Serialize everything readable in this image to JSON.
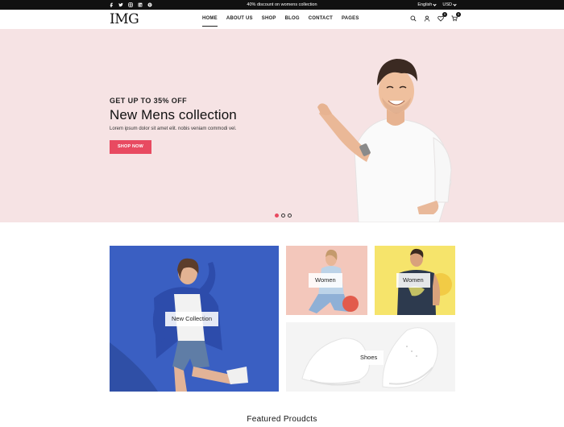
{
  "topbar": {
    "socials": [
      "facebook-icon",
      "twitter-icon",
      "instagram-icon",
      "linkedin-icon",
      "pinterest-icon"
    ],
    "promo": "40% discount on womens collection",
    "language": "English",
    "currency": "USD"
  },
  "header": {
    "logo": "IMG",
    "nav": [
      "HOME",
      "ABOUT US",
      "SHOP",
      "BLOG",
      "CONTACT",
      "PAGES"
    ],
    "active_nav": "HOME",
    "wishlist_count": "0",
    "cart_count": "0"
  },
  "hero": {
    "subtitle": "GET UP TO 35% OFF",
    "title": "New Mens collection",
    "description": "Lorem ipsum dolor sit amet elit. nobis veniam commodi vel.",
    "button": "SHOP NOW",
    "slides": 3,
    "active_slide": 1
  },
  "categories": [
    {
      "label": "New Collection"
    },
    {
      "label": "Women"
    },
    {
      "label": "Women"
    },
    {
      "label": "Shoes"
    }
  ],
  "featured": {
    "title": "Featured Proudcts"
  },
  "colors": {
    "accent": "#e84a61",
    "hero_bg": "#f6e3e4",
    "topbar_bg": "#111111"
  }
}
